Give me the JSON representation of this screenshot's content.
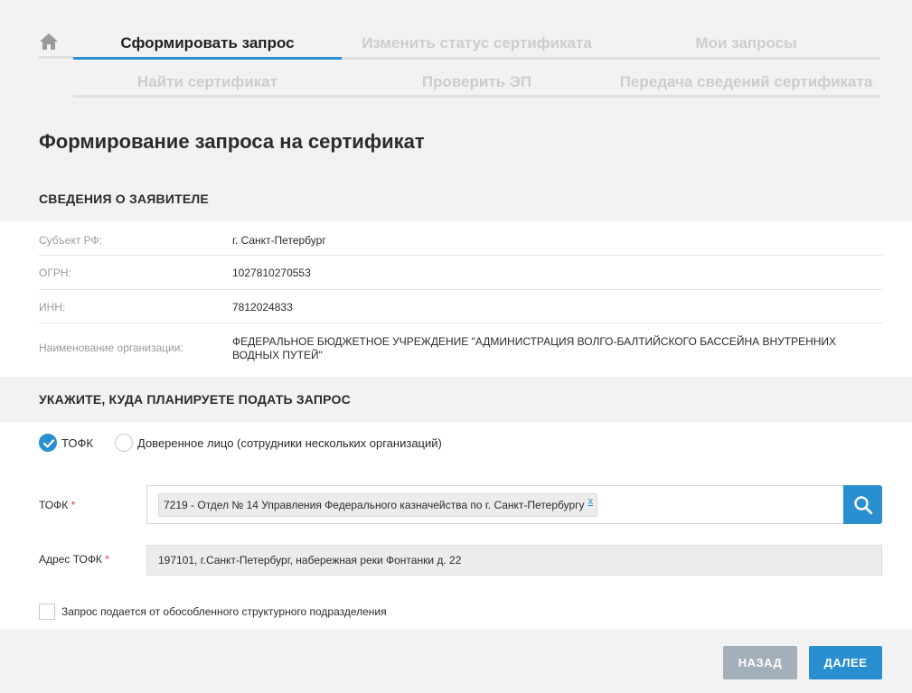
{
  "tabs": {
    "row1": [
      "Сформировать запрос",
      "Изменить статус сертификата",
      "Мои запросы"
    ],
    "row2": [
      "Найти сертификат",
      "Проверить ЭП",
      "Передача сведений сертификата"
    ]
  },
  "page_title": "Формирование запроса на сертификат",
  "applicant": {
    "heading": "СВЕДЕНИЯ О ЗАЯВИТЕЛЕ",
    "rows": [
      {
        "label": "Субъект РФ:",
        "value": "г. Санкт-Петербург"
      },
      {
        "label": "ОГРН:",
        "value": "1027810270553"
      },
      {
        "label": "ИНН:",
        "value": "7812024833"
      },
      {
        "label": "Наименование организации:",
        "value": "ФЕДЕРАЛЬНОЕ БЮДЖЕТНОЕ УЧРЕЖДЕНИЕ \"АДМИНИСТРАЦИЯ ВОЛГО-БАЛТИЙСКОГО БАССЕЙНА ВНУТРЕННИХ ВОДНЫХ ПУТЕЙ\""
      }
    ]
  },
  "destination": {
    "heading": "УКАЖИТЕ, КУДА ПЛАНИРУЕТЕ ПОДАТЬ ЗАПРОС",
    "radio_tofk": "ТОФК",
    "radio_trusted": "Доверенное лицо (сотрудники нескольких организаций)"
  },
  "form": {
    "tofk_label": "ТОФК",
    "tofk_chip": "7219 - Отдел № 14 Управления Федерального казначейства по г. Санкт-Петербургу",
    "tofk_chip_remove": "x",
    "address_label": "Адрес ТОФК",
    "address_value": "197101, г.Санкт-Петербург, набережная реки Фонтанки д. 22",
    "required_mark": "*",
    "separate_unit_label": "Запрос подается от обособленного структурного подразделения"
  },
  "buttons": {
    "back": "НАЗАД",
    "next": "ДАЛЕЕ"
  },
  "colors": {
    "accent": "#2a8fd0",
    "back_button": "#a3afb9",
    "required": "#e03c3c"
  },
  "icons": [
    "home-icon",
    "search-icon",
    "check-icon"
  ]
}
